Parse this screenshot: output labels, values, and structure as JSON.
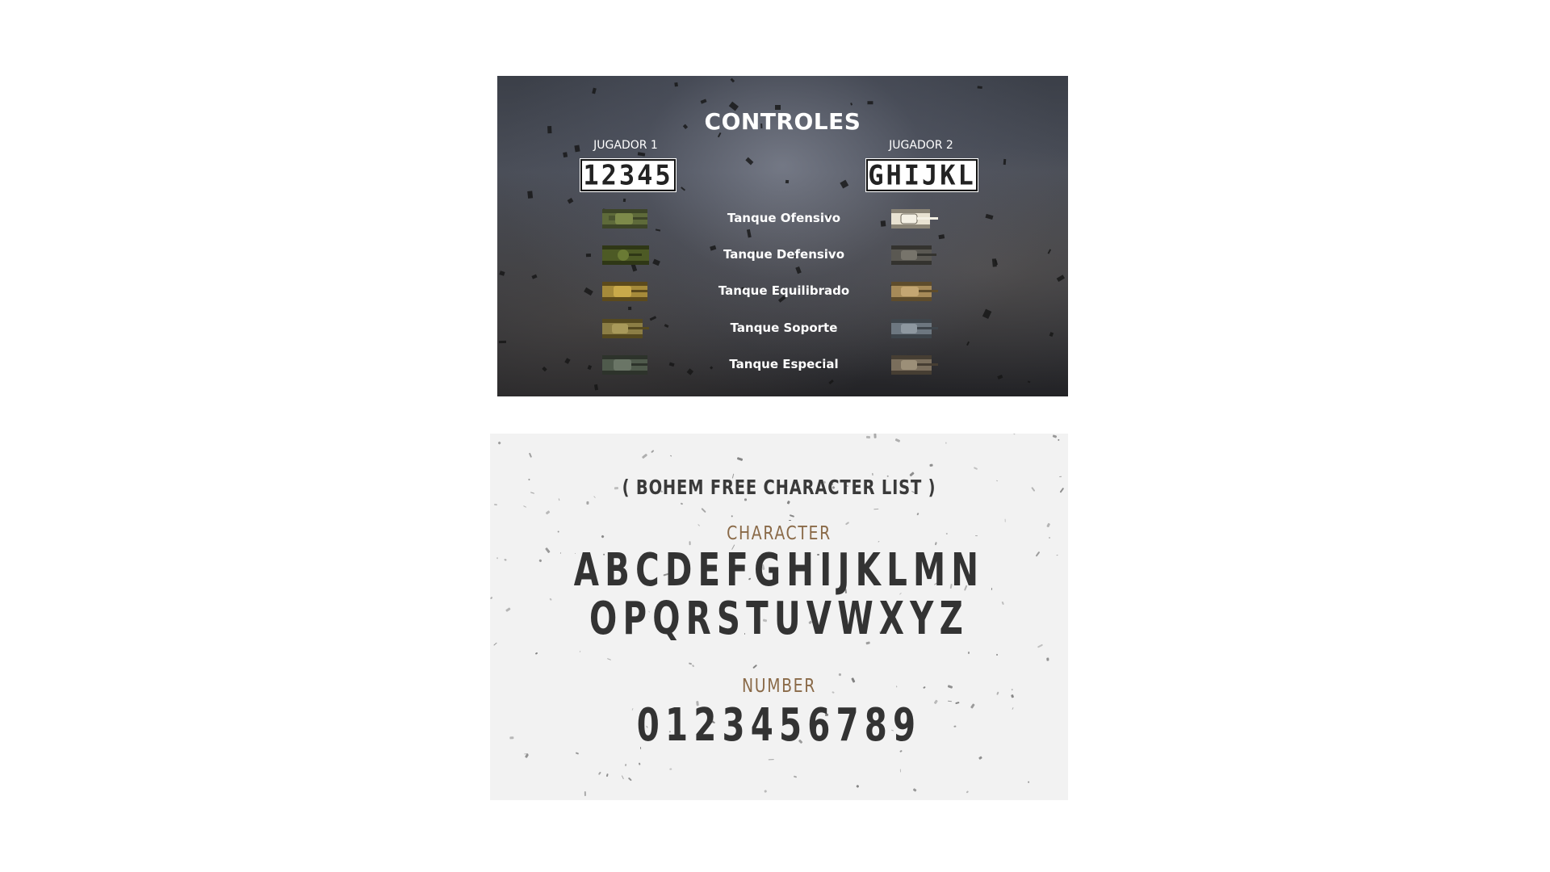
{
  "controls_panel": {
    "title": "CONTROLES",
    "player1": {
      "label": "JUGADOR 1",
      "keys": "12345"
    },
    "player2": {
      "label": "JUGADOR 2",
      "keys": "GHIJKL"
    },
    "tanks": [
      {
        "label": "Tanque Ofensivo"
      },
      {
        "label": "Tanque Defensivo"
      },
      {
        "label": "Tanque Equilibrado"
      },
      {
        "label": "Tanque Soporte"
      },
      {
        "label": "Tanque Especial"
      }
    ]
  },
  "charlist_panel": {
    "title": "( BOHEM FREE CHARACTER LIST )",
    "character_heading": "CHARACTER",
    "alphabet_line1": "ABCDEFGHIJKLMN",
    "alphabet_line2": "OPQRSTUVWXYZ",
    "number_heading": "NUMBER",
    "digits": "0123456789"
  },
  "colors": {
    "heading_brown": "#8a6a48",
    "glyph_dark": "#333333",
    "panel_light": "#f2f2f2"
  }
}
